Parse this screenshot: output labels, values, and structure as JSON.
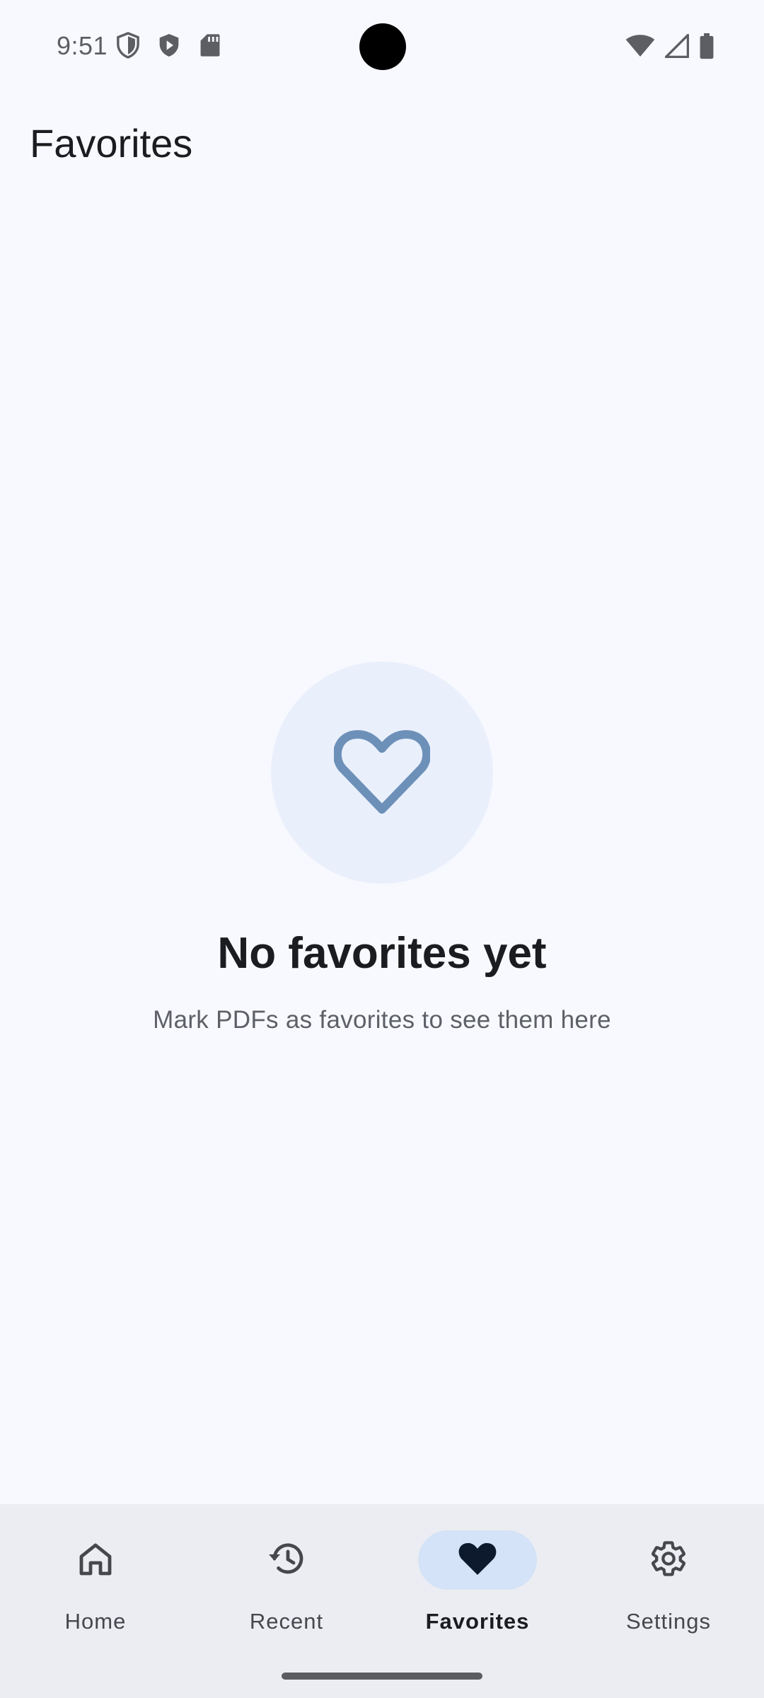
{
  "status_bar": {
    "time": "9:51",
    "icons_left": [
      "shield-outline-icon",
      "play-shield-icon",
      "sd-card-icon"
    ],
    "icons_right": [
      "wifi-icon",
      "cell-signal-icon",
      "battery-icon"
    ]
  },
  "header": {
    "title": "Favorites"
  },
  "empty_state": {
    "icon": "heart-outline-icon",
    "title": "No favorites yet",
    "subtitle": "Mark PDFs as favorites to see them here"
  },
  "bottom_nav": {
    "items": [
      {
        "label": "Home",
        "icon": "home-icon",
        "active": false
      },
      {
        "label": "Recent",
        "icon": "history-icon",
        "active": false
      },
      {
        "label": "Favorites",
        "icon": "heart-filled-icon",
        "active": true
      },
      {
        "label": "Settings",
        "icon": "gear-icon",
        "active": false
      }
    ]
  },
  "colors": {
    "background": "#f8f9fe",
    "nav_background": "#ecedf2",
    "active_indicator": "#d4e3f7",
    "empty_circle": "#e9f0fc",
    "heart_outline": "#6d90b8"
  }
}
